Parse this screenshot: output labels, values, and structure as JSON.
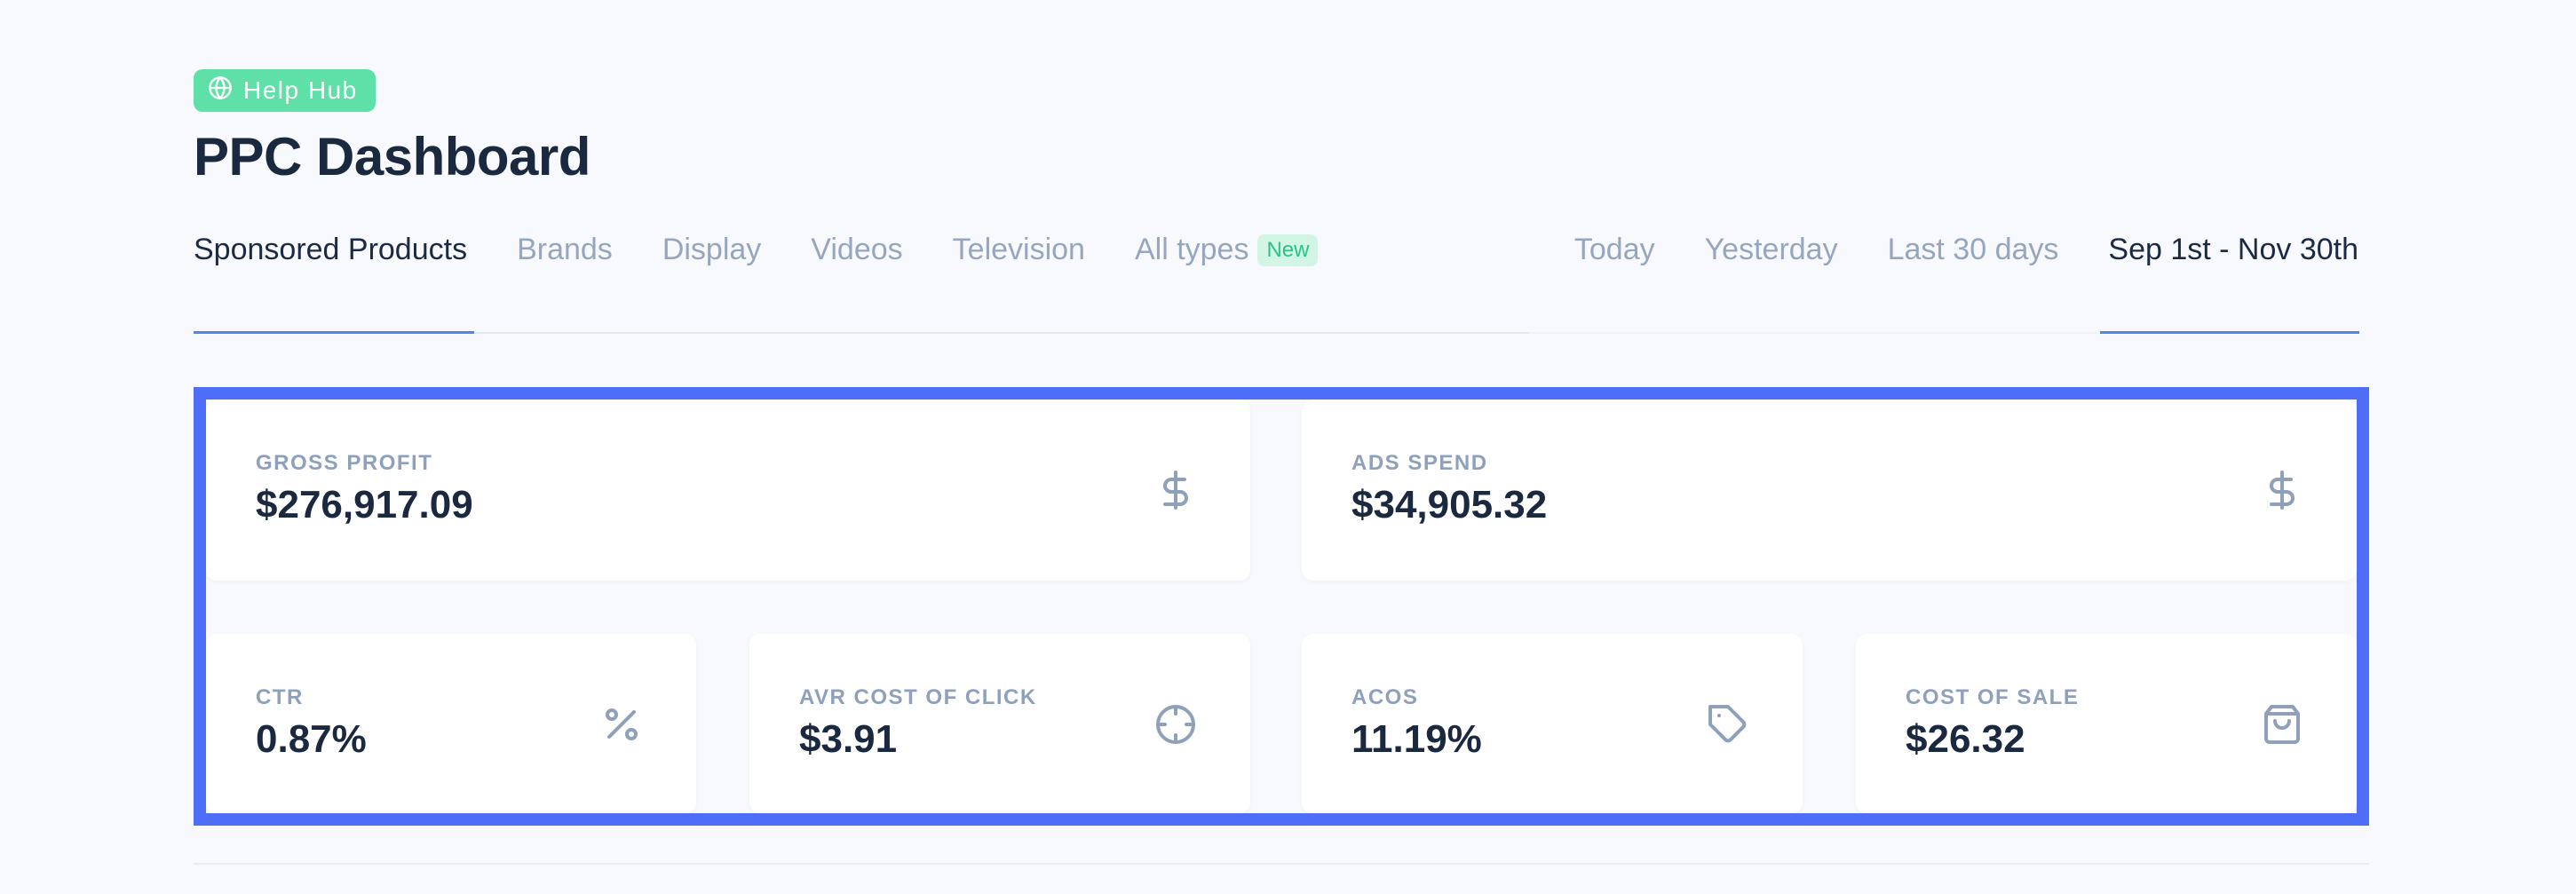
{
  "help_badge": {
    "label": "Help Hub",
    "icon": "globe-icon"
  },
  "page_title": "PPC Dashboard",
  "type_tabs": [
    {
      "label": "Sponsored Products",
      "active": true
    },
    {
      "label": "Brands",
      "active": false
    },
    {
      "label": "Display",
      "active": false
    },
    {
      "label": "Videos",
      "active": false
    },
    {
      "label": "Television",
      "active": false
    },
    {
      "label": "All types",
      "active": false,
      "badge": "New"
    }
  ],
  "date_tabs": [
    {
      "label": "Today",
      "active": false
    },
    {
      "label": "Yesterday",
      "active": false
    },
    {
      "label": "Last 30 days",
      "active": false
    },
    {
      "label": "Sep 1st - Nov 30th",
      "active": true
    }
  ],
  "metrics": {
    "gross_profit": {
      "label": "GROSS PROFIT",
      "value": "$276,917.09",
      "icon": "dollar-icon"
    },
    "ads_spend": {
      "label": "ADS SPEND",
      "value": "$34,905.32",
      "icon": "dollar-icon"
    },
    "ctr": {
      "label": "CTR",
      "value": "0.87%",
      "icon": "percent-icon"
    },
    "avr_cost_of_click": {
      "label": "AVR COST OF CLICK",
      "value": "$3.91",
      "icon": "crosshair-icon"
    },
    "acos": {
      "label": "ACOS",
      "value": "11.19%",
      "icon": "tag-icon"
    },
    "cost_of_sale": {
      "label": "COST OF SALE",
      "value": "$26.32",
      "icon": "shopping-bag-icon"
    }
  },
  "colors": {
    "accent": "#4f86ea",
    "highlight_frame": "#4f6ef7",
    "help_badge": "#5fe0a8",
    "new_badge_bg": "#d3f5e6",
    "new_badge_text": "#2cc486"
  }
}
